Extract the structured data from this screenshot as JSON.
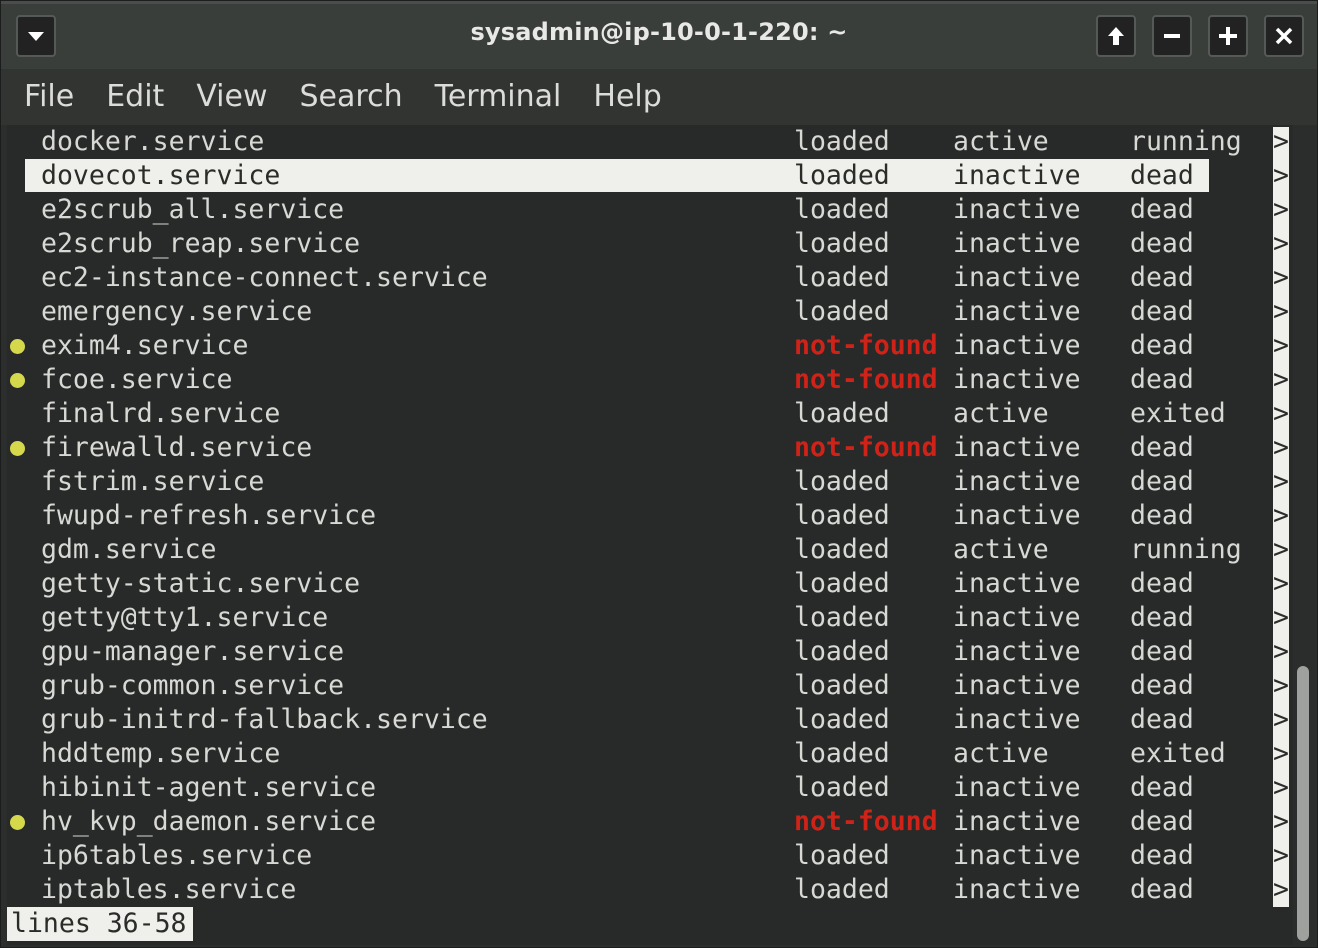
{
  "window": {
    "title": "sysadmin@ip-10-0-1-220: ~",
    "buttons": {
      "menu": "window-menu",
      "raise": "raise-window",
      "minimize": "minimize",
      "maximize": "maximize",
      "close": "close"
    }
  },
  "menubar": {
    "items": [
      "File",
      "Edit",
      "View",
      "Search",
      "Terminal",
      "Help"
    ]
  },
  "terminal": {
    "selected_index": 1,
    "more_indicator": ">",
    "rows": [
      {
        "unit": "docker.service",
        "load": "loaded",
        "active": "active",
        "sub": "running",
        "warn": false
      },
      {
        "unit": "dovecot.service",
        "load": "loaded",
        "active": "inactive",
        "sub": "dead",
        "warn": false
      },
      {
        "unit": "e2scrub_all.service",
        "load": "loaded",
        "active": "inactive",
        "sub": "dead",
        "warn": false
      },
      {
        "unit": "e2scrub_reap.service",
        "load": "loaded",
        "active": "inactive",
        "sub": "dead",
        "warn": false
      },
      {
        "unit": "ec2-instance-connect.service",
        "load": "loaded",
        "active": "inactive",
        "sub": "dead",
        "warn": false
      },
      {
        "unit": "emergency.service",
        "load": "loaded",
        "active": "inactive",
        "sub": "dead",
        "warn": false
      },
      {
        "unit": "exim4.service",
        "load": "not-found",
        "active": "inactive",
        "sub": "dead",
        "warn": true
      },
      {
        "unit": "fcoe.service",
        "load": "not-found",
        "active": "inactive",
        "sub": "dead",
        "warn": true
      },
      {
        "unit": "finalrd.service",
        "load": "loaded",
        "active": "active",
        "sub": "exited",
        "warn": false
      },
      {
        "unit": "firewalld.service",
        "load": "not-found",
        "active": "inactive",
        "sub": "dead",
        "warn": true
      },
      {
        "unit": "fstrim.service",
        "load": "loaded",
        "active": "inactive",
        "sub": "dead",
        "warn": false
      },
      {
        "unit": "fwupd-refresh.service",
        "load": "loaded",
        "active": "inactive",
        "sub": "dead",
        "warn": false
      },
      {
        "unit": "gdm.service",
        "load": "loaded",
        "active": "active",
        "sub": "running",
        "warn": false
      },
      {
        "unit": "getty-static.service",
        "load": "loaded",
        "active": "inactive",
        "sub": "dead",
        "warn": false
      },
      {
        "unit": "getty@tty1.service",
        "load": "loaded",
        "active": "inactive",
        "sub": "dead",
        "warn": false
      },
      {
        "unit": "gpu-manager.service",
        "load": "loaded",
        "active": "inactive",
        "sub": "dead",
        "warn": false
      },
      {
        "unit": "grub-common.service",
        "load": "loaded",
        "active": "inactive",
        "sub": "dead",
        "warn": false
      },
      {
        "unit": "grub-initrd-fallback.service",
        "load": "loaded",
        "active": "inactive",
        "sub": "dead",
        "warn": false
      },
      {
        "unit": "hddtemp.service",
        "load": "loaded",
        "active": "active",
        "sub": "exited",
        "warn": false
      },
      {
        "unit": "hibinit-agent.service",
        "load": "loaded",
        "active": "inactive",
        "sub": "dead",
        "warn": false
      },
      {
        "unit": "hv_kvp_daemon.service",
        "load": "not-found",
        "active": "inactive",
        "sub": "dead",
        "warn": true
      },
      {
        "unit": "ip6tables.service",
        "load": "loaded",
        "active": "inactive",
        "sub": "dead",
        "warn": false
      },
      {
        "unit": "iptables.service",
        "load": "loaded",
        "active": "inactive",
        "sub": "dead",
        "warn": false
      }
    ],
    "status_line": "lines 36-58"
  },
  "scrollbar": {
    "thumb_start_fraction": 0.66,
    "thumb_end_fraction": 0.995
  },
  "colors": {
    "not_found": "#cf2218",
    "warn_dot": "#d6d84b",
    "selection_bg": "#eff0ec",
    "terminal_bg": "#272a28",
    "foreground": "#d8d8d5"
  }
}
